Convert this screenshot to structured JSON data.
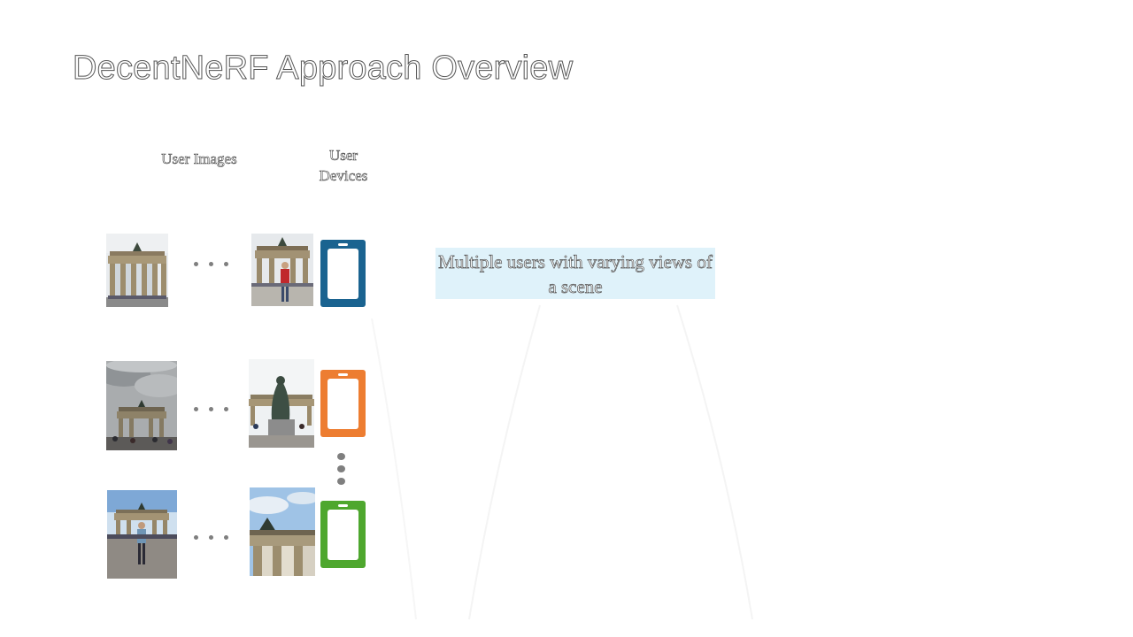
{
  "slide": {
    "title": "DecentNeRF Approach Overview",
    "header_user_images": "User Images",
    "header_user_devices": "User Devices",
    "callout_text": "Multiple users with varying views of a scene"
  },
  "users": [
    {
      "phone_color": "#1a6390"
    },
    {
      "phone_color": "#ed7d31"
    },
    {
      "phone_color": "#4ea72e"
    }
  ],
  "colors": {
    "title_outline": "#555555",
    "callout_bg": "#dff2fa",
    "dots": "#7f7f7f"
  }
}
